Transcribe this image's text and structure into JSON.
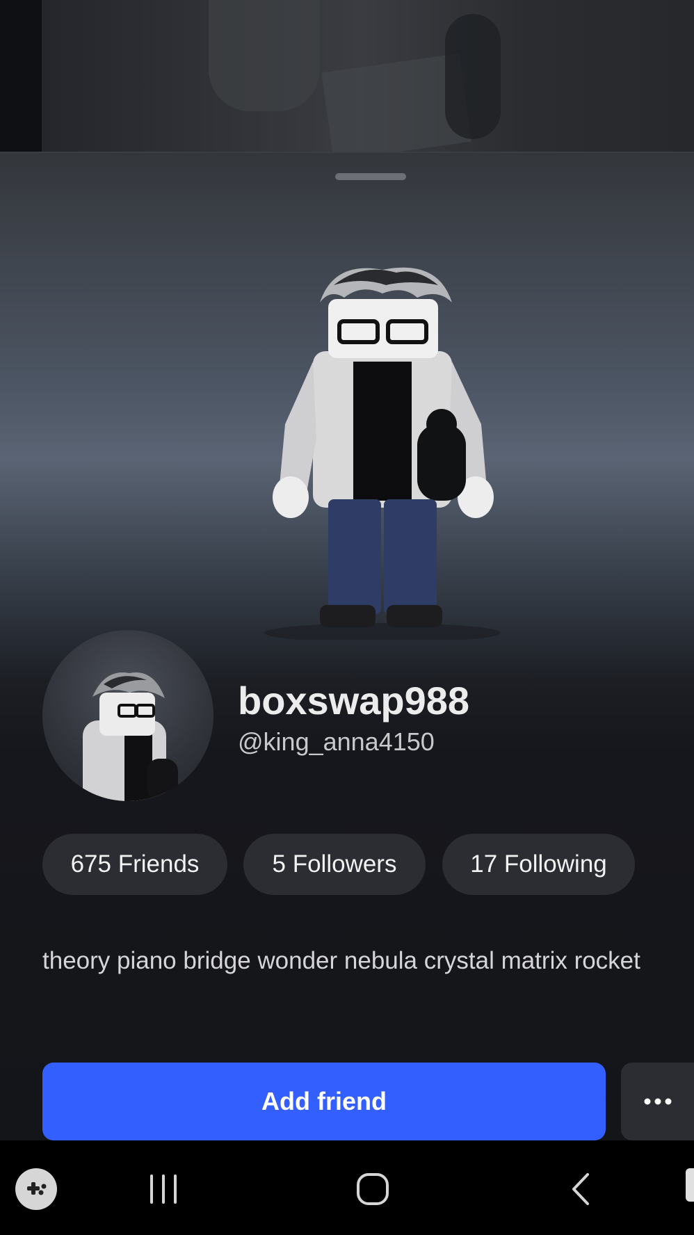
{
  "profile": {
    "display_name": "boxswap988",
    "username": "@king_anna4150",
    "bio": "theory piano bridge wonder nebula crystal matrix rocket"
  },
  "stats": {
    "friends": "675 Friends",
    "followers": "5 Followers",
    "following": "17 Following"
  },
  "actions": {
    "add_friend_label": "Add friend",
    "more_icon": "ellipsis-icon"
  },
  "navbar": {
    "icons": [
      "game-launcher-icon",
      "recent-apps-icon",
      "home-icon",
      "back-icon"
    ]
  },
  "colors": {
    "accent": "#335fff",
    "pill_background": "#2b2d33",
    "sheet_background": "#141519"
  }
}
